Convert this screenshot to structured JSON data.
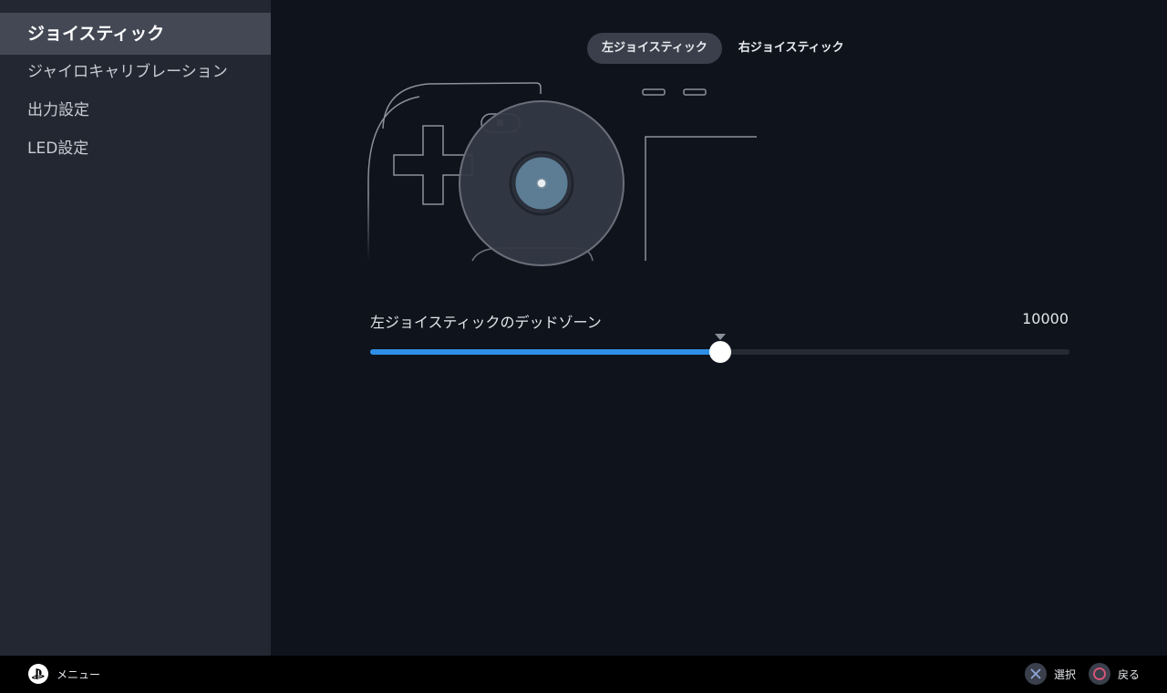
{
  "sidebar": {
    "items": [
      {
        "label": "ジョイスティック",
        "active": true
      },
      {
        "label": "ジャイロキャリブレーション",
        "active": false
      },
      {
        "label": "出力設定",
        "active": false
      },
      {
        "label": "LED設定",
        "active": false
      }
    ]
  },
  "tabs": [
    {
      "label": "左ジョイスティック",
      "active": true
    },
    {
      "label": "右ジョイスティック",
      "active": false
    }
  ],
  "deadzone": {
    "label": "左ジョイスティックのデッドゾーン",
    "value": "10000",
    "fraction": 0.5
  },
  "footer": {
    "menu_label": "メニュー",
    "select_label": "選択",
    "back_label": "戻る",
    "cross_color": "#8fa6d6",
    "circle_color": "#e0567a"
  },
  "colors": {
    "accent": "#2f8fe6",
    "sidebar_bg": "#232731",
    "sidebar_active": "#434854",
    "main_bg": "#0e131c"
  }
}
